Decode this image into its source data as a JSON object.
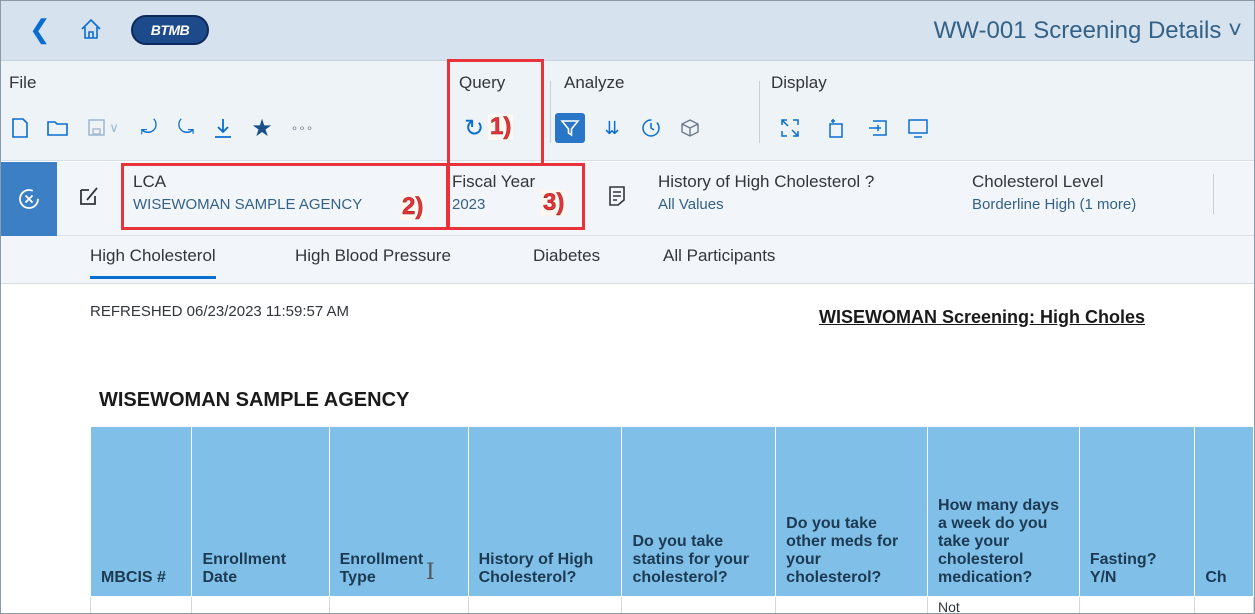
{
  "app": {
    "logo_text": "BTMB",
    "title": "WW-001 Screening Details",
    "title_chevron": "˅"
  },
  "toolbar": {
    "groups": {
      "file": "File",
      "query": "Query",
      "analyze": "Analyze",
      "display": "Display"
    },
    "more_label": "∘∘∘"
  },
  "filters": [
    {
      "name": "LCA",
      "value": "WISEWOMAN SAMPLE AGENCY"
    },
    {
      "name": "Fiscal Year",
      "value": "2023"
    },
    {
      "name": "History of High Cholesterol ?",
      "value": "All Values"
    },
    {
      "name": "Cholesterol Level",
      "value": "Borderline High (1 more)"
    }
  ],
  "tabs": [
    {
      "label": "High Cholesterol",
      "selected": true
    },
    {
      "label": "High Blood Pressure",
      "selected": false
    },
    {
      "label": "Diabetes",
      "selected": false
    },
    {
      "label": "All Participants",
      "selected": false
    }
  ],
  "report": {
    "refreshed": "REFRESHED 06/23/2023 11:59:57 AM",
    "title": "WISEWOMAN Screening: High Choles",
    "agency": "WISEWOMAN SAMPLE AGENCY",
    "columns": [
      "MBCIS #",
      "Enrollment Date",
      "Enrollment Type",
      "History of High Cholesterol?",
      "Do you take statins for your cholesterol?",
      "Do you take other meds for your cholesterol?",
      "How many days a week do you take your cholesterol medication?",
      "Fasting? Y/N",
      "Ch"
    ],
    "first_row_partial": "Not"
  },
  "annotations": [
    "1)",
    "2)",
    "3)"
  ],
  "colors": {
    "accent": "#0a6ed1",
    "header_bg": "#7fbfe8",
    "annotation_red": "#e8333a"
  }
}
